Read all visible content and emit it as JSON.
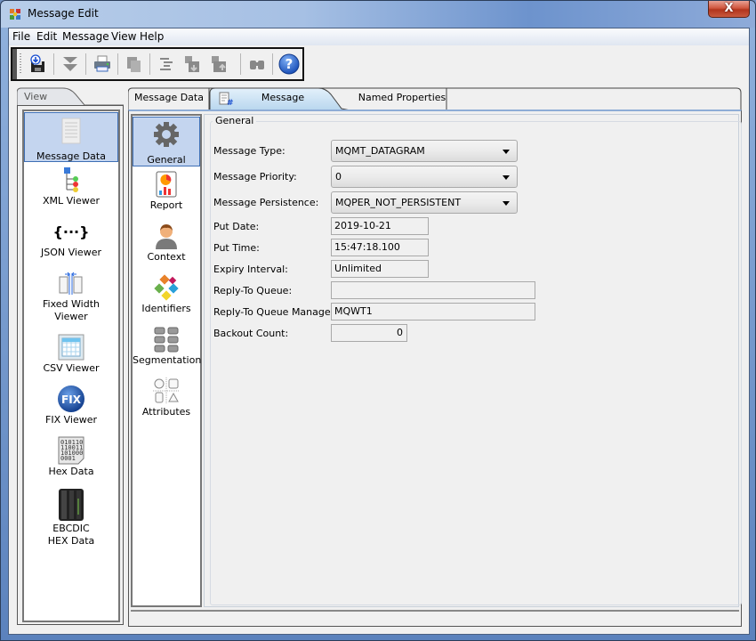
{
  "window": {
    "title": "Message Edit",
    "close_label": "X"
  },
  "menubar": {
    "items": [
      "File",
      "Edit",
      "Message",
      "View",
      "Help"
    ]
  },
  "toolbar": {
    "buttons": [
      {
        "icon": "save-icon",
        "enabled": true
      },
      {
        "icon": "move-down-icon",
        "enabled": false
      },
      {
        "icon": "print-icon",
        "enabled": true
      },
      {
        "icon": "copy-icon",
        "enabled": false
      },
      {
        "icon": "format-icon",
        "enabled": false
      },
      {
        "icon": "insert-icon",
        "enabled": false
      },
      {
        "icon": "remove-icon",
        "enabled": false
      },
      {
        "icon": "find-icon",
        "enabled": false
      },
      {
        "icon": "help-icon",
        "enabled": true
      }
    ]
  },
  "view_panel": {
    "tab_label": "View",
    "items": [
      {
        "label": "Message Data",
        "icon": "document-icon",
        "selected": true
      },
      {
        "label": "XML Viewer",
        "icon": "xml-tree-icon",
        "selected": false
      },
      {
        "label": "JSON Viewer",
        "icon": "json-braces-icon",
        "selected": false
      },
      {
        "label": "Fixed Width Viewer",
        "icon": "fixed-width-icon",
        "selected": false
      },
      {
        "label": "CSV Viewer",
        "icon": "csv-grid-icon",
        "selected": false
      },
      {
        "label": "FIX Viewer",
        "icon": "fix-globe-icon",
        "selected": false
      },
      {
        "label": "Hex Data",
        "icon": "binary-icon",
        "selected": false
      },
      {
        "label": "EBCDIC HEX Data",
        "icon": "mainframe-icon",
        "selected": false
      }
    ]
  },
  "tabs": [
    {
      "label": "Message Data",
      "active": false
    },
    {
      "label": "Message Descriptor",
      "active": true,
      "icon": "descriptor-icon"
    },
    {
      "label": "Named Properties",
      "active": false
    }
  ],
  "categories": [
    {
      "label": "General",
      "icon": "gear-icon",
      "selected": true
    },
    {
      "label": "Report",
      "icon": "report-icon",
      "selected": false
    },
    {
      "label": "Context",
      "icon": "user-icon",
      "selected": false
    },
    {
      "label": "Identifiers",
      "icon": "identifiers-icon",
      "selected": false
    },
    {
      "label": "Segmentation",
      "icon": "segmentation-icon",
      "selected": false
    },
    {
      "label": "Attributes",
      "icon": "attributes-icon",
      "selected": false
    }
  ],
  "form": {
    "group_title": "General",
    "message_type": {
      "label": "Message Type:",
      "value": "MQMT_DATAGRAM"
    },
    "message_priority": {
      "label": "Message Priority:",
      "value": "0"
    },
    "message_persistence": {
      "label": "Message Persistence:",
      "value": "MQPER_NOT_PERSISTENT"
    },
    "put_date": {
      "label": "Put Date:",
      "value": "2019-10-21"
    },
    "put_time": {
      "label": "Put Time:",
      "value": "15:47:18.100"
    },
    "expiry_interval": {
      "label": "Expiry Interval:",
      "value": "Unlimited"
    },
    "reply_to_queue": {
      "label": "Reply-To Queue:",
      "value": ""
    },
    "reply_to_qmgr": {
      "label": "Reply-To Queue Manager:",
      "value": "MQWT1"
    },
    "backout_count": {
      "label": "Backout Count:",
      "value": "0"
    }
  }
}
